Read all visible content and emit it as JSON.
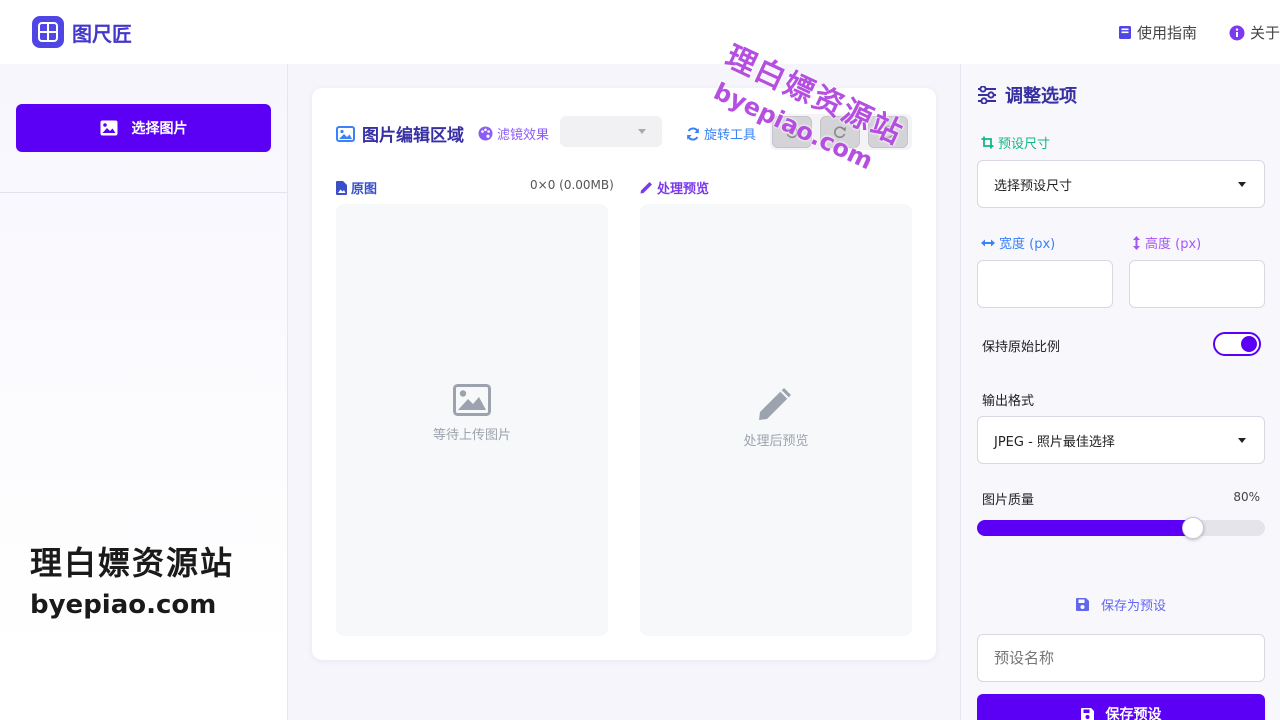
{
  "header": {
    "app_name": "图尺匠",
    "nav": [
      {
        "label": "使用指南",
        "icon": "book-icon"
      },
      {
        "label": "关于",
        "icon": "info-icon"
      }
    ]
  },
  "sidebar": {
    "select_button": "选择图片"
  },
  "watermark": {
    "line1": "理白嫖资源站",
    "line2": "byepiao.com"
  },
  "editor": {
    "title": "图片编辑区域",
    "filter_label": "滤镜效果",
    "filter_value": "",
    "rotate_label": "旋转工具",
    "original_label": "原图",
    "size_info": "0×0 (0.00MB)",
    "preview_label": "处理预览",
    "original_placeholder": "等待上传图片",
    "preview_placeholder": "处理后预览"
  },
  "options": {
    "title": "调整选项",
    "preset_size_label": "预设尺寸",
    "preset_size_value": "选择预设尺寸",
    "width_label": "宽度 (px)",
    "width_value": "",
    "height_label": "高度 (px)",
    "height_value": "",
    "keep_ratio_label": "保持原始比例",
    "keep_ratio_on": true,
    "format_label": "输出格式",
    "format_value": "JPEG - 照片最佳选择",
    "quality_label": "图片质量",
    "quality_text": "80%",
    "quality_fraction": 0.8,
    "save_preset_link": "保存为预设",
    "preset_name_placeholder": "预设名称",
    "save_preset_button": "保存预设"
  },
  "colors": {
    "primary": "#5b00f5",
    "title": "#3730a3",
    "accent_green": "#10b981",
    "accent_blue": "#3b82f6",
    "accent_purple": "#8b5cf6"
  }
}
